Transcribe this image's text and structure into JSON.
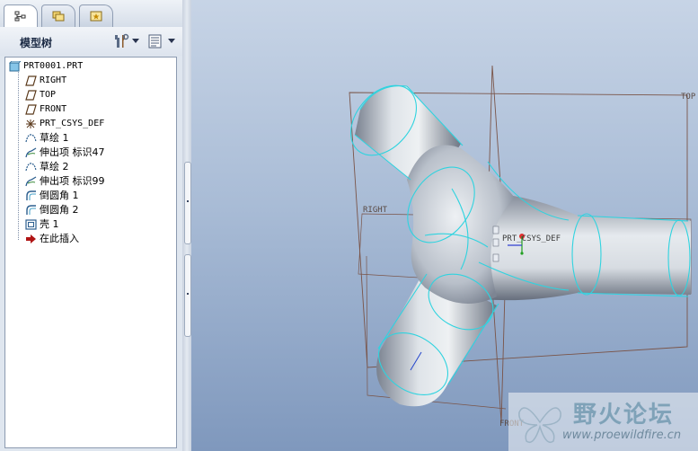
{
  "tabs": [
    {
      "name": "model-tree",
      "icon": "tree-icon",
      "active": true
    },
    {
      "name": "folders",
      "icon": "folders-icon",
      "active": false
    },
    {
      "name": "favorites",
      "icon": "favorites-star-icon",
      "active": false
    }
  ],
  "panel": {
    "title": "模型树",
    "settings_icon": "tree-settings-icon",
    "show_icon": "show-list-icon"
  },
  "tree": {
    "root": {
      "label": "PRT0001.PRT",
      "icon": "part-icon"
    },
    "items": [
      {
        "label": "RIGHT",
        "icon": "datum-plane-icon",
        "mono": true
      },
      {
        "label": "TOP",
        "icon": "datum-plane-icon",
        "mono": true
      },
      {
        "label": "FRONT",
        "icon": "datum-plane-icon",
        "mono": true
      },
      {
        "label": "PRT_CSYS_DEF",
        "icon": "csys-icon",
        "mono": true
      },
      {
        "label": "草绘 1",
        "icon": "sketch-icon",
        "mono": false
      },
      {
        "label": "伸出项 标识47",
        "icon": "extrude-icon",
        "mono": false
      },
      {
        "label": "草绘 2",
        "icon": "sketch-icon",
        "mono": false
      },
      {
        "label": "伸出项 标识99",
        "icon": "extrude-icon",
        "mono": false
      },
      {
        "label": "倒圆角 1",
        "icon": "round-icon",
        "mono": false
      },
      {
        "label": "倒圆角 2",
        "icon": "round-icon",
        "mono": false
      },
      {
        "label": "壳 1",
        "icon": "shell-icon",
        "mono": false
      },
      {
        "label": "在此插入",
        "icon": "insert-here-arrow-icon",
        "mono": false
      }
    ]
  },
  "viewport": {
    "datum_labels": {
      "top": "TOP",
      "right": "RIGHT",
      "csys": "PRT_CSYS_DEF",
      "front": "FRONT"
    },
    "colors": {
      "edge": "#2fd3df",
      "datum": "#7a5448",
      "body_light": "#e8ecef",
      "body_dark": "#7a8290"
    }
  },
  "watermark": {
    "title": "野火论坛",
    "url": "www.proewildfire.cn"
  }
}
